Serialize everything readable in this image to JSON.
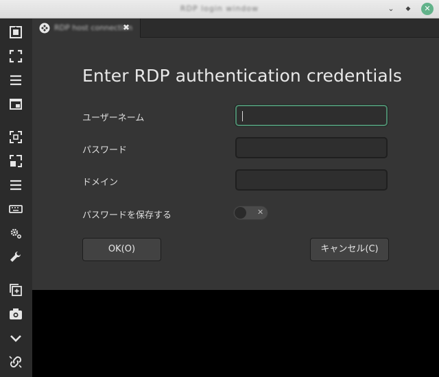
{
  "window": {
    "title": "RDP login window",
    "controls": [
      "minimize",
      "maximize",
      "close"
    ],
    "accent_color": "#62b28a"
  },
  "sidebar": {
    "icons": [
      "connection-icon",
      "fullscreen-icon",
      "menu-icon",
      "window-icon",
      "fit-window-icon",
      "scale-icon",
      "list-icon",
      "keyboard-icon",
      "preferences-icon",
      "tools-icon",
      "duplicate-icon",
      "screenshot-icon",
      "chevron-down-icon",
      "disconnect-icon"
    ]
  },
  "tab": {
    "title": "RDP host connection",
    "close": "✖"
  },
  "dialog": {
    "heading": "Enter RDP authentication credentials",
    "fields": [
      {
        "label": "ユーザーネーム",
        "value": "",
        "placeholder": ""
      },
      {
        "label": "パスワード",
        "value": "",
        "placeholder": ""
      },
      {
        "label": "ドメイン",
        "value": "",
        "placeholder": ""
      }
    ],
    "save_password_label": "パスワードを保存する",
    "save_password_enabled": false,
    "toggle_off_glyph": "✕",
    "ok_label": "OK(O)",
    "cancel_label": "キャンセル(C)"
  }
}
